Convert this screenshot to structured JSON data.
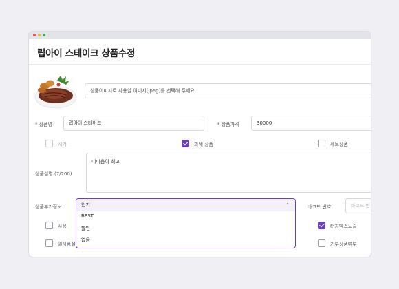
{
  "window": {
    "title": "립아이 스테이크 상품수정"
  },
  "image_section": {
    "file_placeholder": "상품이미지로 사용할 이미지(jpeg)를 선택해 주세요."
  },
  "product": {
    "name_label": "* 상품명",
    "name_value": "립아이 스테이크",
    "price_label": "* 상품가격",
    "price_value": "30000"
  },
  "flags_row1": [
    {
      "label": "시가",
      "checked": false
    },
    {
      "label": "과세 상품",
      "checked": true
    },
    {
      "label": "세트상품",
      "checked": false
    }
  ],
  "description": {
    "label": "상품설명 (7/200)",
    "value": "미디움이 최고"
  },
  "extra_info": {
    "label": "상품부가정보",
    "selected": "인기",
    "options": [
      "BEST",
      "할인",
      "없음"
    ]
  },
  "barcode": {
    "label": "바코드 번호",
    "placeholder": "바코드 번"
  },
  "flags_row2": [
    {
      "label": "사용",
      "checked": false
    },
    {
      "label": "터치박스노출",
      "checked": true
    }
  ],
  "flags_row3": [
    {
      "label": "일시품절",
      "checked": false
    },
    {
      "label": "기부상품여부",
      "checked": false
    }
  ],
  "colors": {
    "accent": "#6b3fb8"
  }
}
